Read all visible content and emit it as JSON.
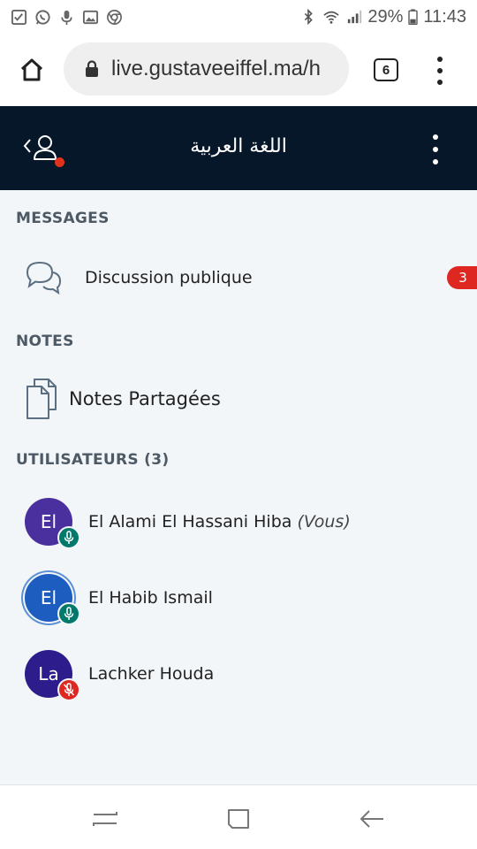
{
  "status_bar": {
    "battery": "29%",
    "time": "11:43",
    "icons": [
      "checkbox-icon",
      "whatsapp-icon",
      "mic-icon",
      "image-icon",
      "chrome-sync-icon",
      "bluetooth-icon",
      "wifi-icon",
      "signal-icon",
      "battery-icon"
    ]
  },
  "browser": {
    "url": "live.gustaveeiffel.ma/h",
    "tab_count": "6"
  },
  "app_header": {
    "title": "اللغة العربية",
    "notification_color": "#e0321c"
  },
  "sections": {
    "messages": {
      "title": "MESSAGES",
      "items": [
        {
          "label": "Discussion publique",
          "unread": "3",
          "icon": "chat-icon"
        }
      ]
    },
    "notes": {
      "title": "NOTES",
      "items": [
        {
          "label": "Notes Partagées",
          "icon": "shared-notes-icon"
        }
      ]
    },
    "users": {
      "title": "UTILISATEURS (3)",
      "items": [
        {
          "initials": "El",
          "name": "El Alami El Hassani Hiba",
          "suffix": "(Vous)",
          "avatar_color": "#4a2f9e",
          "mic_state": "on",
          "mic_color": "#00796b"
        },
        {
          "initials": "El",
          "name": "El Habib Ismail",
          "suffix": "",
          "avatar_color": "#1c5dbf",
          "mic_state": "on",
          "mic_color": "#00796b"
        },
        {
          "initials": "La",
          "name": "Lachker Houda",
          "suffix": "",
          "avatar_color": "#2c1c8c",
          "mic_state": "muted",
          "mic_color": "#df2721"
        }
      ]
    }
  }
}
